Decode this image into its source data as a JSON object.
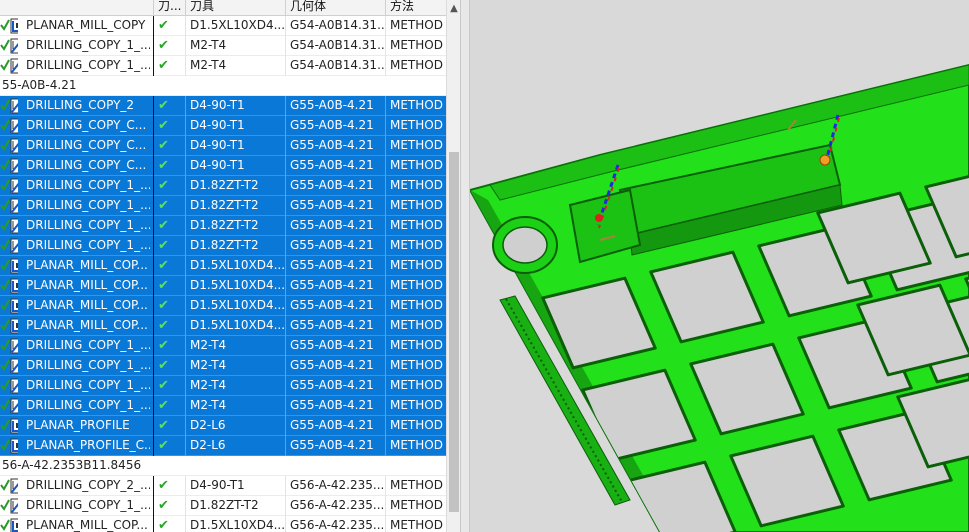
{
  "columns": {
    "check": "刀...",
    "tool": "刀具",
    "geometry": "几何体",
    "method": "方法"
  },
  "rows": [
    {
      "type": "op",
      "name": "PLANAR_MILL_COPY",
      "tool": "D1.5XL10XD4...",
      "geometry": "G54-A0B14.31...",
      "method": "METHOD",
      "selected": false,
      "icon": "planar"
    },
    {
      "type": "op",
      "name": "DRILLING_COPY_1_...",
      "tool": "M2-T4",
      "geometry": "G54-A0B14.31...",
      "method": "METHOD",
      "selected": false,
      "icon": "drill"
    },
    {
      "type": "op",
      "name": "DRILLING_COPY_1_...",
      "tool": "M2-T4",
      "geometry": "G54-A0B14.31...",
      "method": "METHOD",
      "selected": false,
      "icon": "drill"
    },
    {
      "type": "group",
      "label": "55-A0B-4.21"
    },
    {
      "type": "op",
      "name": "DRILLING_COPY_2",
      "tool": "D4-90-T1",
      "geometry": "G55-A0B-4.21",
      "method": "METHOD",
      "selected": true,
      "icon": "drill"
    },
    {
      "type": "op",
      "name": "DRILLING_COPY_C...",
      "tool": "D4-90-T1",
      "geometry": "G55-A0B-4.21",
      "method": "METHOD",
      "selected": true,
      "icon": "drill"
    },
    {
      "type": "op",
      "name": "DRILLING_COPY_C...",
      "tool": "D4-90-T1",
      "geometry": "G55-A0B-4.21",
      "method": "METHOD",
      "selected": true,
      "icon": "drill"
    },
    {
      "type": "op",
      "name": "DRILLING_COPY_C...",
      "tool": "D4-90-T1",
      "geometry": "G55-A0B-4.21",
      "method": "METHOD",
      "selected": true,
      "icon": "drill"
    },
    {
      "type": "op",
      "name": "DRILLING_COPY_1_...",
      "tool": "D1.82ZT-T2",
      "geometry": "G55-A0B-4.21",
      "method": "METHOD",
      "selected": true,
      "icon": "drill"
    },
    {
      "type": "op",
      "name": "DRILLING_COPY_1_...",
      "tool": "D1.82ZT-T2",
      "geometry": "G55-A0B-4.21",
      "method": "METHOD",
      "selected": true,
      "icon": "drill"
    },
    {
      "type": "op",
      "name": "DRILLING_COPY_1_...",
      "tool": "D1.82ZT-T2",
      "geometry": "G55-A0B-4.21",
      "method": "METHOD",
      "selected": true,
      "icon": "drill"
    },
    {
      "type": "op",
      "name": "DRILLING_COPY_1_...",
      "tool": "D1.82ZT-T2",
      "geometry": "G55-A0B-4.21",
      "method": "METHOD",
      "selected": true,
      "icon": "drill"
    },
    {
      "type": "op",
      "name": "PLANAR_MILL_COP...",
      "tool": "D1.5XL10XD4...",
      "geometry": "G55-A0B-4.21",
      "method": "METHOD",
      "selected": true,
      "icon": "planar"
    },
    {
      "type": "op",
      "name": "PLANAR_MILL_COP...",
      "tool": "D1.5XL10XD4...",
      "geometry": "G55-A0B-4.21",
      "method": "METHOD",
      "selected": true,
      "icon": "planar"
    },
    {
      "type": "op",
      "name": "PLANAR_MILL_COP...",
      "tool": "D1.5XL10XD4...",
      "geometry": "G55-A0B-4.21",
      "method": "METHOD",
      "selected": true,
      "icon": "planar"
    },
    {
      "type": "op",
      "name": "PLANAR_MILL_COP...",
      "tool": "D1.5XL10XD4...",
      "geometry": "G55-A0B-4.21",
      "method": "METHOD",
      "selected": true,
      "icon": "planar"
    },
    {
      "type": "op",
      "name": "DRILLING_COPY_1_...",
      "tool": "M2-T4",
      "geometry": "G55-A0B-4.21",
      "method": "METHOD",
      "selected": true,
      "icon": "drill"
    },
    {
      "type": "op",
      "name": "DRILLING_COPY_1_...",
      "tool": "M2-T4",
      "geometry": "G55-A0B-4.21",
      "method": "METHOD",
      "selected": true,
      "icon": "drill"
    },
    {
      "type": "op",
      "name": "DRILLING_COPY_1_...",
      "tool": "M2-T4",
      "geometry": "G55-A0B-4.21",
      "method": "METHOD",
      "selected": true,
      "icon": "drill"
    },
    {
      "type": "op",
      "name": "DRILLING_COPY_1_...",
      "tool": "M2-T4",
      "geometry": "G55-A0B-4.21",
      "method": "METHOD",
      "selected": true,
      "icon": "drill"
    },
    {
      "type": "op",
      "name": "PLANAR_PROFILE",
      "tool": "D2-L6",
      "geometry": "G55-A0B-4.21",
      "method": "METHOD",
      "selected": true,
      "icon": "planar"
    },
    {
      "type": "op",
      "name": "PLANAR_PROFILE_C...",
      "tool": "D2-L6",
      "geometry": "G55-A0B-4.21",
      "method": "METHOD",
      "selected": true,
      "icon": "planar"
    },
    {
      "type": "group",
      "label": "56-A-42.2353B11.8456"
    },
    {
      "type": "op",
      "name": "DRILLING_COPY_2_...",
      "tool": "D4-90-T1",
      "geometry": "G56-A-42.235...",
      "method": "METHOD",
      "selected": false,
      "icon": "drill"
    },
    {
      "type": "op",
      "name": "DRILLING_COPY_1_...",
      "tool": "D1.82ZT-T2",
      "geometry": "G56-A-42.235...",
      "method": "METHOD",
      "selected": false,
      "icon": "drill"
    },
    {
      "type": "op",
      "name": "PLANAR_MILL_COP...",
      "tool": "D1.5XL10XD4...",
      "geometry": "G56-A-42.235...",
      "method": "METHOD",
      "selected": false,
      "icon": "planar"
    }
  ],
  "colors": {
    "selection": "#0a78d7",
    "model": "#22e01a",
    "check": "#28a428",
    "viewport_bg": "#d9d9d9"
  }
}
